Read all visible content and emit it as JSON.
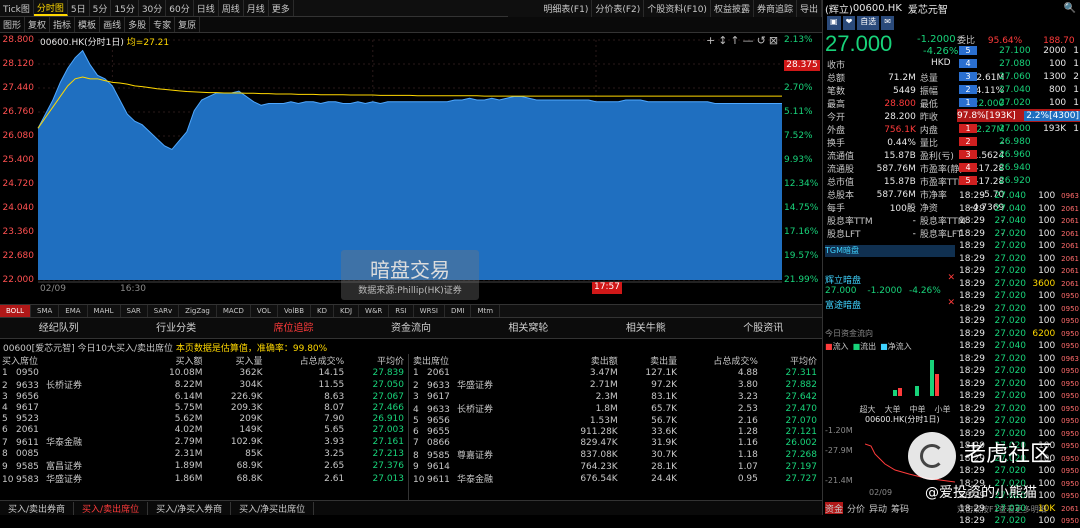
{
  "toolbar": {
    "items": [
      "Tick图",
      "分时图",
      "5日",
      "5分",
      "15分",
      "30分",
      "60分",
      "日线",
      "周线",
      "月线",
      "更多"
    ],
    "active": "分时图",
    "right": [
      "明细表(F1)",
      "分价表(F2)",
      "个股资料(F10)",
      "权益披露",
      "券商追踪",
      "导出"
    ]
  },
  "toolbar2": {
    "items": [
      "图形",
      "复权",
      "指标",
      "模板",
      "画线",
      "多股",
      "专家",
      "复原"
    ]
  },
  "chart": {
    "legend": "00600.HK(分时1日)",
    "avg_label": "均=27.21",
    "y_left": [
      "28.800",
      "28.120",
      "27.440",
      "26.760",
      "26.080",
      "25.400",
      "24.720",
      "24.040",
      "23.360",
      "22.680",
      "22.000"
    ],
    "y_right": [
      "2.13%",
      "",
      "2.70%",
      "5.11%",
      "7.52%",
      "9.93%",
      "12.34%",
      "14.75%",
      "17.16%",
      "19.57%",
      "21.99%"
    ],
    "cur_price": "28.375",
    "x_labels": [
      "02/09",
      "16:30"
    ],
    "time_tag": "17:57",
    "watermark_title": "暗盘交易",
    "watermark_sub": "数据来源:Phillip(HK)证券"
  },
  "chart_data": {
    "type": "area",
    "x": [
      0,
      3,
      6,
      9,
      12,
      15,
      18,
      21,
      24,
      27,
      30,
      33,
      36,
      39,
      42,
      45,
      48,
      51,
      54,
      57,
      60,
      63,
      66,
      69,
      72,
      75,
      78,
      81,
      84,
      87,
      90,
      93,
      96,
      99,
      102,
      105,
      108,
      111,
      114,
      117,
      120,
      123,
      126,
      129,
      132,
      135,
      138,
      141,
      144,
      147,
      150,
      153,
      156,
      159,
      162,
      165,
      168,
      171,
      174,
      177,
      180,
      183,
      186,
      189,
      192,
      195,
      198,
      201,
      204,
      207,
      210,
      213,
      216,
      219,
      222,
      225,
      228,
      231,
      234,
      237,
      240,
      243,
      246,
      249,
      252,
      255,
      258,
      261,
      264,
      267,
      270,
      273,
      276,
      279,
      282,
      285,
      288,
      291,
      294,
      297,
      300
    ],
    "price": [
      26.3,
      26.7,
      27.1,
      27.6,
      28.0,
      28.3,
      28.5,
      28.1,
      27.8,
      27.7,
      27.5,
      27.1,
      26.7,
      26.5,
      26.4,
      26.2,
      26.0,
      25.8,
      25.7,
      25.95,
      26.2,
      26.8,
      27.1,
      27.2,
      27.3,
      27.3,
      27.3,
      27.35,
      27.2,
      27.05,
      26.95,
      27.0,
      27.0,
      27.0,
      27.05,
      27.0,
      27.05,
      27.05,
      27.0,
      27.05,
      27.05,
      27.0,
      27.0,
      27.05,
      27.0,
      27.05,
      27.0,
      27.05,
      27.05,
      27.05,
      27.05,
      27.05,
      27.05,
      27.05,
      27.05,
      27.05,
      27.1,
      27.1,
      27.15,
      27.1,
      27.1,
      27.15,
      27.1,
      27.15,
      27.2,
      27.2,
      27.15,
      27.1,
      27.1,
      27.1,
      27.1,
      27.1,
      27.1,
      27.1,
      27.1,
      27.05,
      27.05,
      27.05,
      27.05,
      27.1,
      27.1,
      27.1,
      27.05,
      27.05,
      27.05,
      27.05,
      27.05,
      27.05,
      27.05,
      27.05,
      27.05,
      27.0,
      27.0,
      27.0,
      27.0,
      27.0,
      27.0,
      27.0,
      27.0,
      27.0,
      27.0
    ],
    "avg": [
      26.3,
      26.6,
      26.9,
      27.2,
      27.5,
      27.7,
      27.75,
      27.7,
      27.7,
      27.65,
      27.6,
      27.58,
      27.55,
      27.5,
      27.48,
      27.45,
      27.42,
      27.4,
      27.38,
      27.36,
      27.34,
      27.33,
      27.32,
      27.31,
      27.31,
      27.3,
      27.3,
      27.3,
      27.29,
      27.29,
      27.28,
      27.28,
      27.27,
      27.27,
      27.27,
      27.26,
      27.26,
      27.26,
      27.25,
      27.25,
      27.25,
      27.25,
      27.24,
      27.24,
      27.24,
      27.24,
      27.23,
      27.23,
      27.23,
      27.23,
      27.23,
      27.22,
      27.22,
      27.22,
      27.22,
      27.22,
      27.22,
      27.22,
      27.22,
      27.22,
      27.21,
      27.21,
      27.21,
      27.21,
      27.21,
      27.21,
      27.21,
      27.21,
      27.21,
      27.21,
      27.21,
      27.21,
      27.21,
      27.21,
      27.21,
      27.21,
      27.21,
      27.21,
      27.21,
      27.21,
      27.21,
      27.21,
      27.21,
      27.21,
      27.21,
      27.21,
      27.21,
      27.21,
      27.21,
      27.21,
      27.21,
      27.21,
      27.21,
      27.21,
      27.21,
      27.21,
      27.21,
      27.21,
      27.21,
      27.21,
      27.21
    ],
    "ylim": [
      22.0,
      28.8
    ],
    "ylabel": "",
    "xlabel": ""
  },
  "indicators": [
    "BOLL",
    "SMA",
    "EMA",
    "MAHL",
    "SAR",
    "SARv",
    "ZigZag",
    "MACD",
    "VOL",
    "VolBB",
    "KD",
    "KDJ",
    "W&R",
    "RSI",
    "WRSI",
    "DMI",
    "Mtm"
  ],
  "indicator_active": "BOLL",
  "tabs": [
    "经纪队列",
    "行业分类",
    "席位追踪",
    "资金流向",
    "相关窝轮",
    "相关牛熊",
    "个股资讯"
  ],
  "tab_active": "席位追踪",
  "seat_info": {
    "title": "00600[爱芯元智] 今日10大买入/卖出席位",
    "note": "本页数据是估算值，准确率：99.80%"
  },
  "buy_headers": [
    "买入席位",
    "买入额",
    "买入量",
    "占总成交%",
    "平均价"
  ],
  "sell_headers": [
    "卖出席位",
    "卖出额",
    "卖出量",
    "占总成交%",
    "平均价"
  ],
  "buy_rows": [
    [
      "1",
      "0950",
      "",
      "10.08M",
      "362K",
      "14.15",
      "27.839"
    ],
    [
      "2",
      "9633",
      "长桥证券",
      "8.22M",
      "304K",
      "11.55",
      "27.050"
    ],
    [
      "3",
      "9656",
      "",
      "6.14M",
      "226.9K",
      "8.63",
      "27.067"
    ],
    [
      "4",
      "9617",
      "",
      "5.75M",
      "209.3K",
      "8.07",
      "27.466"
    ],
    [
      "5",
      "9523",
      "",
      "5.62M",
      "209K",
      "7.90",
      "26.910"
    ],
    [
      "6",
      "2061",
      "",
      "4.02M",
      "149K",
      "5.65",
      "27.003"
    ],
    [
      "7",
      "9611",
      "华泰金融",
      "2.79M",
      "102.9K",
      "3.93",
      "27.161"
    ],
    [
      "8",
      "0085",
      "",
      "2.31M",
      "85K",
      "3.25",
      "27.213"
    ],
    [
      "9",
      "9585",
      "富昌证券",
      "1.89M",
      "68.9K",
      "2.65",
      "27.376"
    ],
    [
      "10",
      "9583",
      "华盛证券",
      "1.86M",
      "68.8K",
      "2.61",
      "27.013"
    ]
  ],
  "sell_rows": [
    [
      "1",
      "2061",
      "",
      "3.47M",
      "127.1K",
      "4.88",
      "27.311"
    ],
    [
      "2",
      "9633",
      "华盛证券",
      "2.71M",
      "97.2K",
      "3.80",
      "27.882"
    ],
    [
      "3",
      "9617",
      "",
      "2.3M",
      "83.1K",
      "3.23",
      "27.642"
    ],
    [
      "4",
      "9633",
      "长桥证券",
      "1.8M",
      "65.7K",
      "2.53",
      "27.470"
    ],
    [
      "5",
      "9656",
      "",
      "1.53M",
      "56.7K",
      "2.16",
      "27.070"
    ],
    [
      "6",
      "9655",
      "",
      "911.28K",
      "33.6K",
      "1.28",
      "27.121"
    ],
    [
      "7",
      "0866",
      "",
      "829.47K",
      "31.9K",
      "1.16",
      "26.002"
    ],
    [
      "8",
      "9585",
      "尊嘉证券",
      "837.08K",
      "30.7K",
      "1.18",
      "27.268"
    ],
    [
      "9",
      "9614",
      "",
      "764.23K",
      "28.1K",
      "1.07",
      "27.197"
    ],
    [
      "10",
      "9611",
      "华泰金融",
      "676.54K",
      "24.4K",
      "0.95",
      "27.727"
    ]
  ],
  "bottom_tabs": [
    "买入/卖出券商",
    "买入/卖出席位",
    "买入/净买入券商",
    "买入/净买出席位"
  ],
  "bottom_active": "买入/卖出席位",
  "quote": {
    "tag": "(辉立)",
    "code": "00600.HK",
    "name": "爱芯元智",
    "badges": [
      "▣",
      "❤",
      "自选",
      "✉"
    ],
    "price": "27.000",
    "chg": "-1.2000",
    "pct": "-4.26%",
    "currency": "HKD",
    "weibi_label": "委比",
    "weibi": "95.64%",
    "weicha": "188.70",
    "stats": [
      [
        "收市",
        "",
        "",
        ""
      ],
      [
        "总额",
        "71.2M",
        "总量",
        "2.61M"
      ],
      [
        "笔数",
        "5449",
        "振幅",
        "24.11%"
      ],
      [
        "最高",
        "28.800",
        "最低",
        "22.000"
      ],
      [
        "今开",
        "28.200",
        "昨收",
        "28.200"
      ],
      [
        "外盘",
        "756.1K",
        "内盘",
        "2.27M"
      ],
      [
        "换手",
        "0.44%",
        "量比",
        "-"
      ],
      [
        "流通值",
        "15.87B",
        "盈利(亏)",
        "-1.5624"
      ],
      [
        "流通股",
        "587.76M",
        "市盈率(静)",
        "-17.28"
      ],
      [
        "总市值",
        "15.87B",
        "市盈率TTM",
        "-17.28"
      ],
      [
        "总股本",
        "587.76M",
        "市净率",
        "-5.70"
      ],
      [
        "每手",
        "100股",
        "净资",
        "-4.7369"
      ],
      [
        "股息率TTM",
        "-",
        "股息率TTM",
        "-"
      ],
      [
        "股息LFT",
        "-",
        "股息率LFT",
        "-"
      ]
    ],
    "dark_title": "TGM暗盘",
    "dark1_title": "辉立暗盘",
    "dark1_price": "27.000",
    "dark1_chg": "-1.2000",
    "dark1_pct": "-4.26%",
    "dark2_title": "富途暗盘",
    "flow_title": "今日资金流向",
    "flow_legend": [
      "流入",
      "流出",
      "净流入"
    ],
    "flow_axis": [
      "超大",
      "大单",
      "中单",
      "小单"
    ],
    "flow_y": [
      "-1.20M",
      "-27.9M",
      "-21.4M"
    ],
    "mini_title": "00600.HK(分时1日)",
    "mini_x": "02/09",
    "bottom": [
      "资金",
      "分价",
      "异动",
      "筹码"
    ],
    "hint": "双击或按F1查看更多明细"
  },
  "asks": [
    [
      "5",
      "27.100",
      "2000",
      "1"
    ],
    [
      "4",
      "27.080",
      "100",
      "1"
    ],
    [
      "3",
      "27.060",
      "1300",
      "2"
    ],
    [
      "2",
      "27.040",
      "800",
      "1"
    ],
    [
      "1",
      "27.020",
      "100",
      "1"
    ]
  ],
  "bid_ratio": {
    "left": "97.8%",
    "left_vol": "[193K]",
    "right": "2.2%",
    "right_vol": "[4300]"
  },
  "bids": [
    [
      "1",
      "27.000",
      "193K",
      "1"
    ],
    [
      "2",
      "26.980",
      "",
      ""
    ],
    [
      "3",
      "26.960",
      "",
      ""
    ],
    [
      "4",
      "26.940",
      "",
      ""
    ],
    [
      "5",
      "26.920",
      "",
      ""
    ]
  ],
  "ticks": [
    [
      "18:29",
      "27.040",
      "100",
      "0963"
    ],
    [
      "18:29",
      "27.040",
      "100",
      "2061"
    ],
    [
      "18:29",
      "27.040",
      "100",
      "2061"
    ],
    [
      "18:29",
      "27.020",
      "100",
      "2061"
    ],
    [
      "18:29",
      "27.020",
      "100",
      "2061"
    ],
    [
      "18:29",
      "27.020",
      "100",
      "2061"
    ],
    [
      "18:29",
      "27.020",
      "100",
      "2061"
    ],
    [
      "18:29",
      "27.020",
      "3600",
      "2061"
    ],
    [
      "18:29",
      "27.020",
      "100",
      "0950"
    ],
    [
      "18:29",
      "27.020",
      "100",
      "0950"
    ],
    [
      "18:29",
      "27.020",
      "100",
      "0950"
    ],
    [
      "18:29",
      "27.020",
      "6200",
      "0950"
    ],
    [
      "18:29",
      "27.040",
      "100",
      "0950"
    ],
    [
      "18:29",
      "27.020",
      "100",
      "0963"
    ],
    [
      "18:29",
      "27.020",
      "100",
      "0950"
    ],
    [
      "18:29",
      "27.020",
      "100",
      "0950"
    ],
    [
      "18:29",
      "27.020",
      "100",
      "0950"
    ],
    [
      "18:29",
      "27.020",
      "100",
      "0950"
    ],
    [
      "18:29",
      "27.020",
      "100",
      "0950"
    ],
    [
      "18:29",
      "27.020",
      "100",
      "0950"
    ],
    [
      "18:29",
      "27.020",
      "100",
      "0950"
    ],
    [
      "18:29",
      "27.020",
      "100",
      "0950"
    ],
    [
      "18:29",
      "27.020",
      "100",
      "0950"
    ],
    [
      "18:29",
      "27.020",
      "100",
      "0950"
    ],
    [
      "18:29",
      "27.020",
      "100",
      "0950"
    ],
    [
      "18:29",
      "27.020",
      "10K",
      "2061"
    ],
    [
      "18:29",
      "27.020",
      "100",
      "0950"
    ]
  ],
  "watermark": {
    "brand": "老虎社区",
    "user": "@爱投资的小熊猫"
  },
  "colors": {
    "up": "#ff3b3b",
    "down": "#18d37a",
    "accent": "#ffd800",
    "area": "#1f6fc0"
  }
}
